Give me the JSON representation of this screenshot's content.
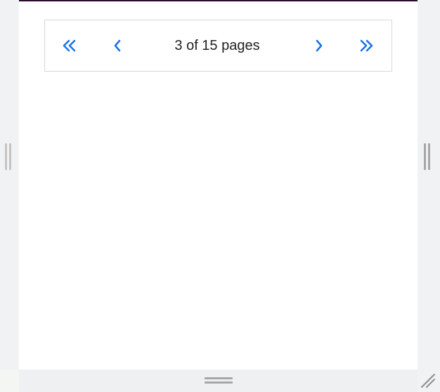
{
  "pager": {
    "page_text": "3 of 15 pages",
    "current_page": 3,
    "total_pages": 15,
    "buttons": [
      {
        "name": "first-page",
        "icon": "double-chevron-left-icon"
      },
      {
        "name": "previous-page",
        "icon": "chevron-left-icon"
      },
      {
        "name": "next-page",
        "icon": "chevron-right-icon"
      },
      {
        "name": "last-page",
        "icon": "double-chevron-right-icon"
      }
    ]
  },
  "colors": {
    "accent": "#1a73e8",
    "frame_top_border": "#2b0a2e",
    "text": "#222222",
    "border": "#d9d9d9",
    "page_background": "#f1f2f4"
  }
}
